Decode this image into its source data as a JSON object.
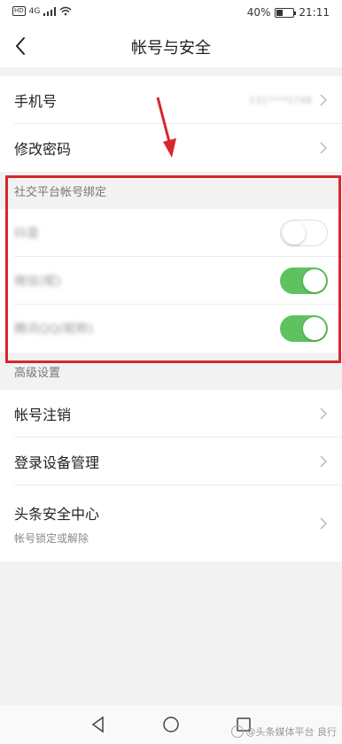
{
  "status_bar": {
    "hd": "HD",
    "signal": "4G",
    "battery_pct_text": "40%",
    "battery_level": 0.4,
    "time": "21:11"
  },
  "header": {
    "title": "帐号与安全"
  },
  "account": {
    "phone_label": "手机号",
    "phone_value": "131****5748",
    "password_label": "修改密码"
  },
  "social": {
    "header": "社交平台帐号绑定",
    "items": [
      {
        "label": "抖音",
        "enabled": false
      },
      {
        "label": "微信(昵)",
        "enabled": true
      },
      {
        "label": "腾讯QQ(昵称)",
        "enabled": true
      }
    ]
  },
  "advanced": {
    "header": "高级设置",
    "items": [
      {
        "label": "帐号注销"
      },
      {
        "label": "登录设备管理"
      },
      {
        "label": "头条安全中心",
        "sub": "帐号锁定或解除"
      }
    ]
  },
  "watermark": {
    "text": "@头条媒体平台 良行"
  },
  "colors": {
    "toggle_on": "#5ec35e",
    "highlight": "#d9262c"
  }
}
